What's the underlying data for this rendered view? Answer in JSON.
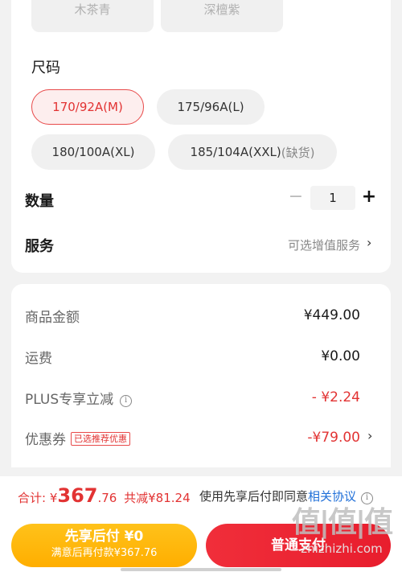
{
  "colors": {
    "options": [
      "木茶青",
      "深檀紫"
    ]
  },
  "size": {
    "title": "尺码",
    "options": [
      {
        "label": "170/92A(M)",
        "selected": true
      },
      {
        "label": "175/96A(L)"
      },
      {
        "label": "180/100A(XL)"
      },
      {
        "label": "185/104A(XXL)",
        "note": "(缺货)"
      }
    ]
  },
  "quantity": {
    "title": "数量",
    "minus": "−",
    "value": "1",
    "plus": "+"
  },
  "service": {
    "title": "服务",
    "value": "可选增值服务",
    "chevron": "›"
  },
  "fees": {
    "goods_label": "商品金额",
    "goods_value": "¥449.00",
    "shipping_label": "运费",
    "shipping_value": "¥0.00",
    "plus_label": "PLUS专享立减",
    "plus_info": "i",
    "plus_value": "- ¥2.24",
    "coupon_label": "优惠券",
    "coupon_tag": "已选推荐优惠",
    "coupon_value": "-¥79.00",
    "coupon_chevron": "›"
  },
  "summary": {
    "total_label": "合计: ¥",
    "total_big": "367",
    "total_small": ".76",
    "saved": "共减¥81.24",
    "agree_prefix": "使用先享后付即同意",
    "agree_link": "相关协议",
    "agree_info": "i"
  },
  "buttons": {
    "first_pay_title": "先享后付 ¥0",
    "first_pay_sub": "满意后再付款¥367.76",
    "normal_pay": "普通支付"
  },
  "watermark": {
    "logo": "值|值|值",
    "url": "zhizhizhi.com"
  },
  "theme": {
    "accent_red": "#e23333",
    "accent_yellow": "#ffb300",
    "link_blue": "#1f6fd8"
  }
}
